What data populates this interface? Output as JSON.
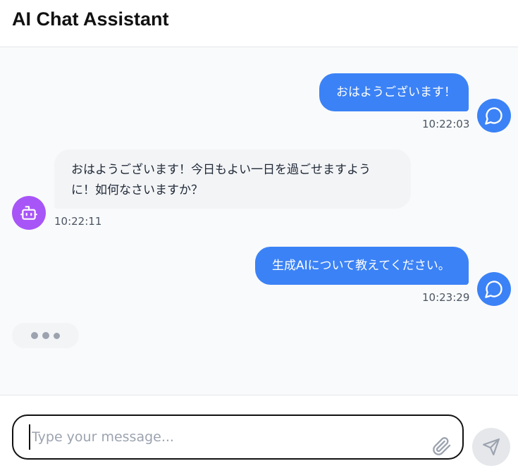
{
  "header": {
    "title": "AI Chat Assistant"
  },
  "messages": [
    {
      "role": "user",
      "text": "おはようございます！",
      "time": "10:22:03",
      "avatar_icon": "chat-bubble-icon"
    },
    {
      "role": "assistant",
      "text_line1": "おはようございます！今日もよい一日を過ごせますよう",
      "text_line2": "に！如何なさいますか？",
      "time": "10:22:11",
      "avatar_icon": "robot-icon"
    },
    {
      "role": "user",
      "text": "生成AIについて教えてください。",
      "time": "10:23:29",
      "avatar_icon": "chat-bubble-icon"
    }
  ],
  "typing_indicator": {
    "visible": true,
    "icon": "typing-dots-icon"
  },
  "composer": {
    "placeholder": "Type your message...",
    "value": "",
    "attach_icon": "paperclip-icon",
    "send_icon": "send-icon"
  },
  "colors": {
    "user_bubble": "#3b82f6",
    "bot_bubble": "#f3f4f6",
    "bot_avatar": "#a855f7",
    "background": "#f9fafb"
  }
}
